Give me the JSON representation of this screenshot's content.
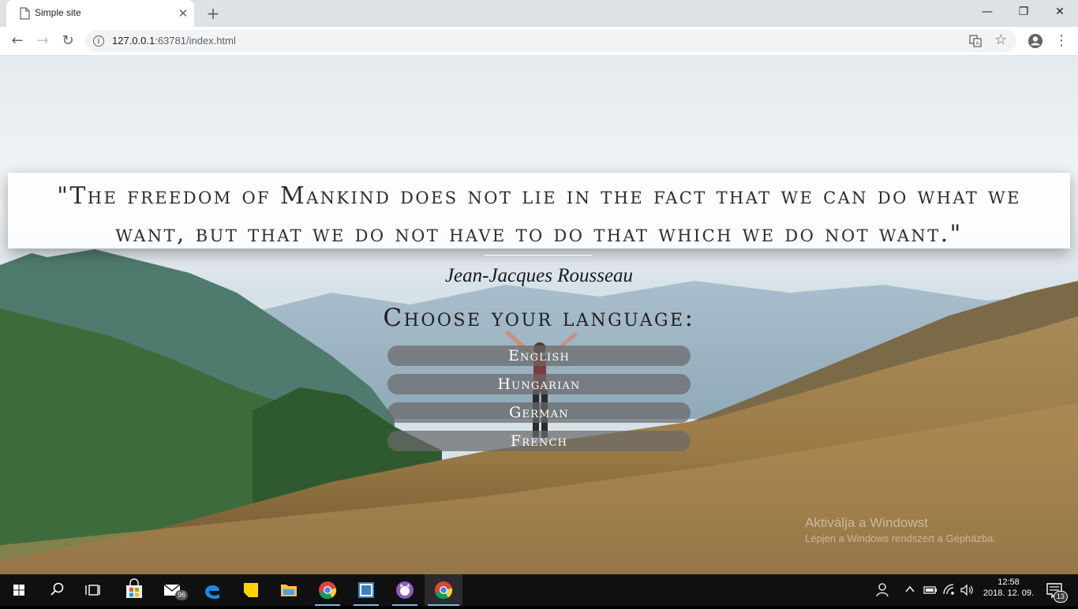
{
  "browser": {
    "tab_title": "Simple site",
    "url_host": "127.0.0.1",
    "url_rest": ":63781/index.html",
    "window_controls": {
      "minimize": "—",
      "maximize": "❐",
      "close": "✕"
    },
    "new_tab": "+",
    "tab_close": "✕"
  },
  "page": {
    "quote_line1": "\"The freedom of Mankind does not lie in the fact that we can do what we",
    "quote_line2": "want, but that we do not have to do that which we do not want.\"",
    "author": "Jean-Jacques Rousseau",
    "choose_label": "Choose your language:",
    "languages": [
      "English",
      "Hungarian",
      "German",
      "French"
    ]
  },
  "watermark": {
    "title": "Aktiválja a Windowst",
    "subtitle": "Lépjen a Windows rendszert a Gépházba."
  },
  "taskbar": {
    "mail_badge": "96",
    "time": "12:58",
    "date": "2018. 12. 09.",
    "notification_count": "13"
  },
  "colors": {
    "taskbar_bg": "#101010",
    "accent": "#76b9ed",
    "lang_button_bg": "rgba(105,105,105,0.72)"
  }
}
